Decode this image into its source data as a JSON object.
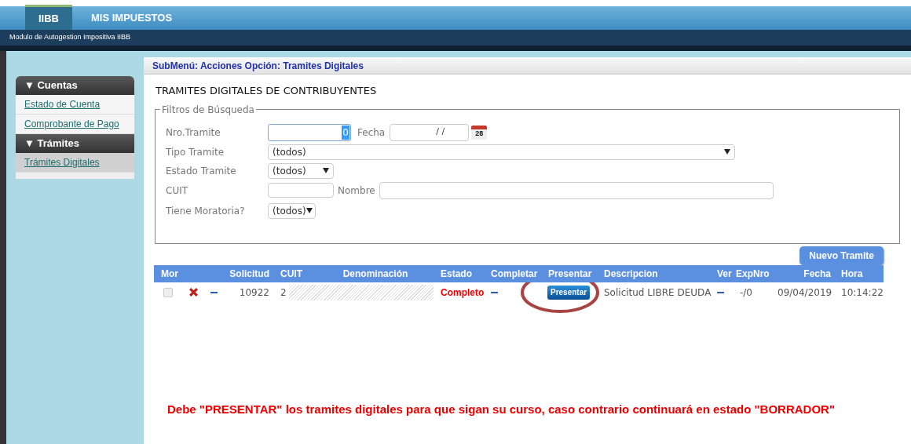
{
  "top_tabs": [
    {
      "label": "IIBB",
      "selected": true
    },
    {
      "label": "MIS IMPUESTOS",
      "selected": false
    }
  ],
  "subtitle": "Modulo de Autogestion Impositiva IIBB",
  "sidebar": {
    "sections": [
      {
        "title": "▼ Cuentas",
        "items": [
          {
            "label": "Estado de Cuenta",
            "selected": false
          },
          {
            "label": "Comprobante de Pago",
            "selected": false
          }
        ]
      },
      {
        "title": "▼ Trámites",
        "items": [
          {
            "label": "Trámites Digitales",
            "selected": true
          }
        ]
      }
    ]
  },
  "breadcrumb": "SubMenú: Acciones Opción: Tramites Digitales",
  "page_title": "TRAMITES DIGITALES DE CONTRIBUYENTES",
  "filters": {
    "legend": "Filtros de Búsqueda",
    "nro_tramite": {
      "label": "Nro.Tramite",
      "value": "0"
    },
    "fecha": {
      "label": "Fecha",
      "value": "/ /",
      "calendar_day": "28"
    },
    "tipo_tramite": {
      "label": "Tipo Tramite",
      "value": "(todos)"
    },
    "estado_tramite": {
      "label": "Estado Tramite",
      "value": "(todos)"
    },
    "cuit": {
      "label": "CUIT"
    },
    "nombre": {
      "label": "Nombre"
    },
    "moratoria": {
      "label": "Tiene Moratoria?",
      "value": "(todos)"
    }
  },
  "new_button": "Nuevo Tramite",
  "table": {
    "columns": [
      "Mor",
      "Solicitud",
      "CUIT",
      "Denominación",
      "Estado",
      "Completar",
      "Presentar",
      "Descripcion",
      "Ver",
      "ExpNro",
      "Fecha",
      "Hora"
    ],
    "rows": [
      {
        "mor_checked": false,
        "solicitud": "10922",
        "cuit": "2",
        "estado": "Completo",
        "presentar": "Presentar",
        "descripcion": "Solicitud LIBRE DEUDA",
        "exp_nro": "-/0",
        "fecha": "09/04/2019",
        "hora": "10:14:22"
      }
    ]
  },
  "notice": "Debe \"PRESENTAR\" los tramites digitales para que sigan su curso, caso contrario continuará en estado \"BORRADOR\""
}
